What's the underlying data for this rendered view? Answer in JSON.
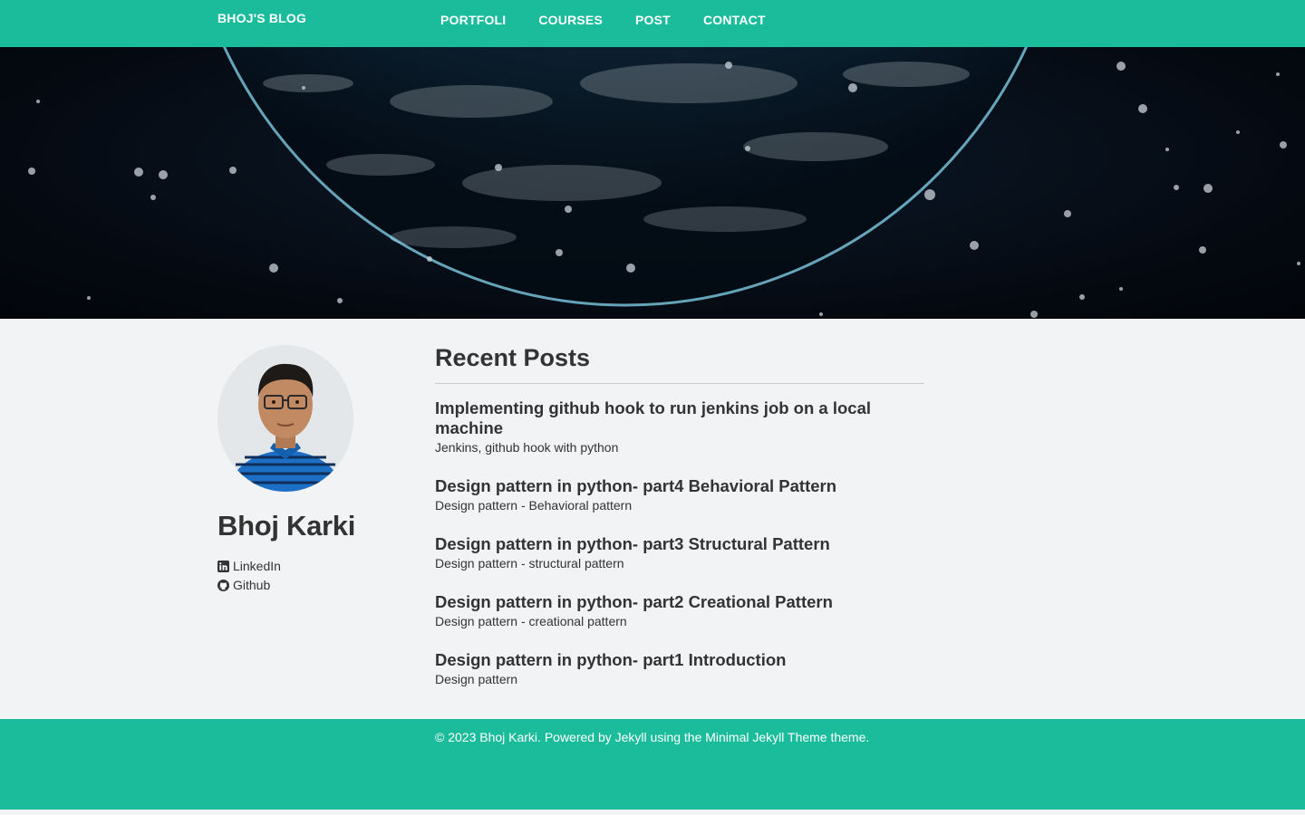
{
  "site": {
    "brand": "BHOJ'S BLOG"
  },
  "nav": {
    "items": [
      {
        "label": "PORTFOLI"
      },
      {
        "label": "COURSES"
      },
      {
        "label": "POST"
      },
      {
        "label": "CONTACT"
      }
    ]
  },
  "author": {
    "name": "Bhoj Karki",
    "social": [
      {
        "label": "LinkedIn",
        "icon": "linkedin-icon"
      },
      {
        "label": "Github",
        "icon": "github-icon"
      }
    ]
  },
  "recent_posts": {
    "heading": "Recent Posts",
    "items": [
      {
        "title": "Implementing github hook to run jenkins job on a local machine",
        "excerpt": "Jenkins, github hook with python"
      },
      {
        "title": "Design pattern in python- part4 Behavioral Pattern",
        "excerpt": "Design pattern - Behavioral pattern"
      },
      {
        "title": "Design pattern in python- part3 Structural Pattern",
        "excerpt": "Design pattern - structural pattern"
      },
      {
        "title": "Design pattern in python- part2 Creational Pattern",
        "excerpt": "Design pattern - creational pattern"
      },
      {
        "title": "Design pattern in python- part1 Introduction",
        "excerpt": "Design pattern"
      }
    ]
  },
  "footer": {
    "text": "© 2023 Bhoj Karki. Powered by Jekyll using the Minimal Jekyll Theme theme."
  },
  "colors": {
    "accent": "#1abc9c",
    "page_background": "#f1f3f5",
    "text": "#333333"
  }
}
